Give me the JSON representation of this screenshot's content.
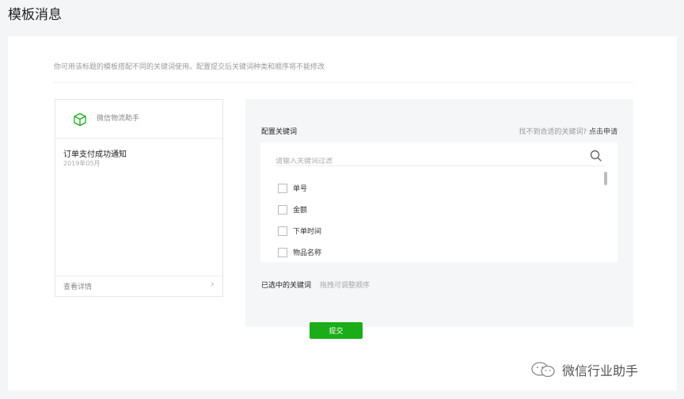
{
  "page": {
    "title": "模板消息"
  },
  "tip": "你可用该标题的模板搭配不同的关键词使用。配置提交后关键词种类和顺序将不能修改",
  "preview": {
    "account_name": "微信物流助手",
    "message_title": "订单支付成功通知",
    "message_date": "2019年05月",
    "detail_link": "查看详情",
    "icons": [
      "package-icon",
      "chevron-right-icon"
    ]
  },
  "config": {
    "label": "配置关键词",
    "hint": "找不到合适的关键词?",
    "apply_link": "点击申请",
    "search": {
      "placeholder": "请输入关键词过滤",
      "value": ""
    },
    "keywords": [
      {
        "label": "单号",
        "checked": false
      },
      {
        "label": "金额",
        "checked": false
      },
      {
        "label": "下单时间",
        "checked": false
      },
      {
        "label": "物品名称",
        "checked": false
      }
    ],
    "selected_label": "已选中的关键词",
    "selected_hint": "拖拽可调整顺序"
  },
  "submit_label": "提交",
  "watermark": "微信行业助手",
  "colors": {
    "accent": "#1aad19",
    "background": "#f4f5f7",
    "panel": "#f5f6f7"
  }
}
